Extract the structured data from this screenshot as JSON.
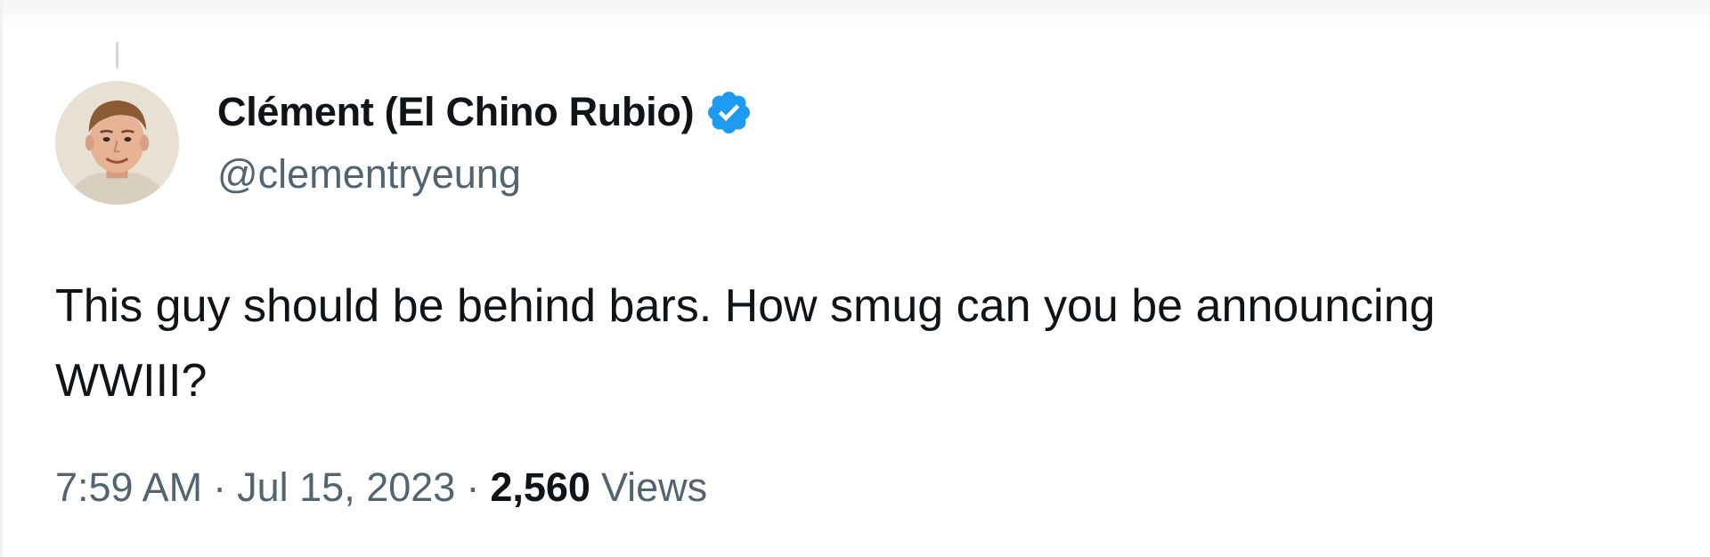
{
  "author": {
    "display_name": "Clément (El Chino Rubio)",
    "handle": "@clementryeung",
    "verified": true,
    "avatar_icon": "profile-photo"
  },
  "tweet": {
    "text_line1": "This guy should be behind bars. How smug can you be announcing",
    "text_line2": "WWIII?"
  },
  "meta": {
    "time": "7:59 AM",
    "separator": "·",
    "date": "Jul 15, 2023",
    "views_count": "2,560",
    "views_label": "Views"
  },
  "colors": {
    "text_primary": "#0f1419",
    "text_secondary": "#536471",
    "verified_blue": "#1d9bf0",
    "thread_line": "#cfd9de"
  }
}
